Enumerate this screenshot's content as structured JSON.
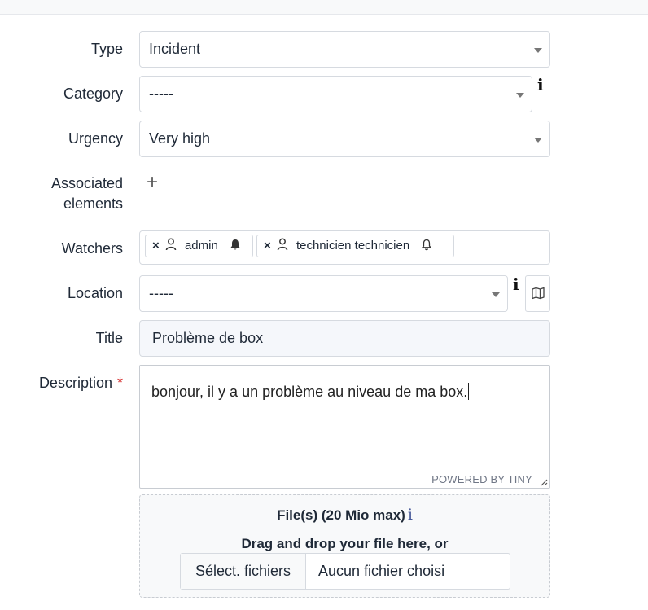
{
  "form": {
    "type": {
      "label": "Type",
      "value": "Incident"
    },
    "category": {
      "label": "Category",
      "value": "-----",
      "info_glyph": "i"
    },
    "urgency": {
      "label": "Urgency",
      "value": "Very high"
    },
    "associated": {
      "label_line1": "Associated",
      "label_line2": "elements",
      "add_glyph": "+"
    },
    "watchers": {
      "label": "Watchers",
      "tags": [
        {
          "remove": "×",
          "name": "admin",
          "icon": "user-icon",
          "notify_icon": "bell-filled-icon"
        },
        {
          "remove": "×",
          "name": "technicien technicien",
          "icon": "user-icon",
          "notify_icon": "bell-outline-icon"
        }
      ]
    },
    "location": {
      "label": "Location",
      "value": "-----",
      "info_glyph": "i",
      "map_icon": "map-icon"
    },
    "title": {
      "label": "Title",
      "value": "Problème de box"
    },
    "description": {
      "label": "Description",
      "required_mark": "*",
      "value": "bonjour, il y a un problème au niveau de ma box.",
      "powered_by": "POWERED BY TINY"
    },
    "files": {
      "heading": "File(s) (20 Mio max)",
      "info_glyph": "i",
      "drag_text": "Drag and drop your file here, or",
      "button_label": "Sélect. fichiers",
      "no_file_text": "Aucun fichier choisi"
    }
  },
  "colors": {
    "required": "#d63939",
    "info_blue": "#4a5b9a",
    "border": "#d6dae0"
  }
}
